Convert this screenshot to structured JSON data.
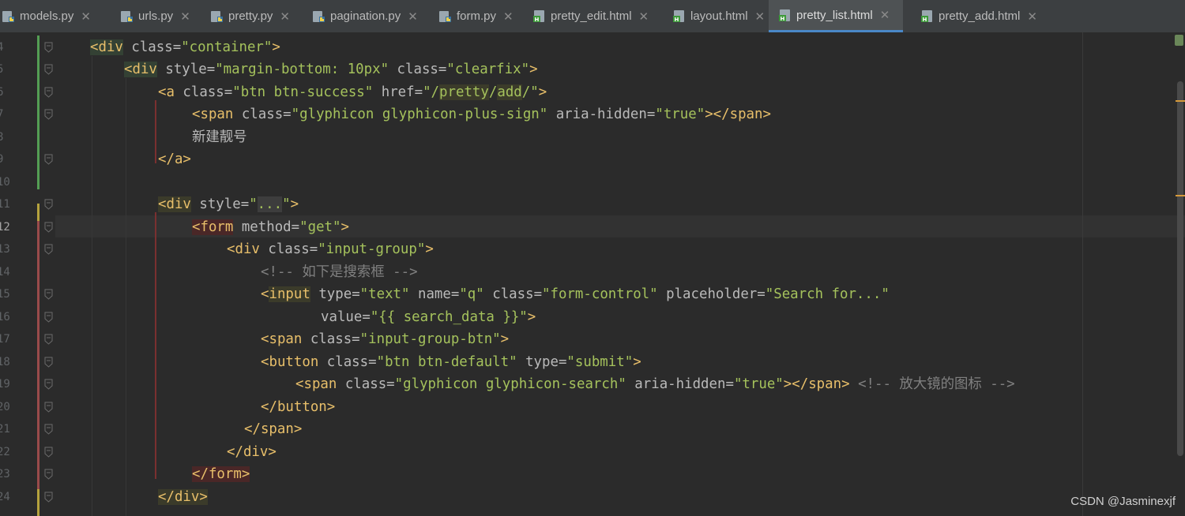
{
  "tabs": [
    {
      "label": "models.py",
      "kind": "python"
    },
    {
      "label": "urls.py",
      "kind": "python"
    },
    {
      "label": "pretty.py",
      "kind": "python"
    },
    {
      "label": "pagination.py",
      "kind": "python"
    },
    {
      "label": "form.py",
      "kind": "python"
    },
    {
      "label": "pretty_edit.html",
      "kind": "html"
    },
    {
      "label": "layout.html",
      "kind": "html"
    },
    {
      "label": "pretty_list.html",
      "kind": "html",
      "active": true
    },
    {
      "label": "pretty_add.html",
      "kind": "html"
    }
  ],
  "close_glyph": "✕",
  "line_numbers": [
    "4",
    "5",
    "6",
    "7",
    "8",
    "9",
    "10",
    "11",
    "12",
    "13",
    "14",
    "15",
    "16",
    "17",
    "18",
    "19",
    "20",
    "21",
    "22",
    "23",
    "24"
  ],
  "current_line": "12",
  "code_lines": [
    "<div class=\"container\">",
    "<div style=\"margin-bottom: 10px\" class=\"clearfix\">",
    "<a class=\"btn btn-success\" href=\"/pretty/add/\">",
    "<span class=\"glyphicon glyphicon-plus-sign\" aria-hidden=\"true\"></span>",
    "新建靓号",
    "</a>",
    "",
    "<div style=\"...\">",
    "<form method=\"get\">",
    "<div class=\"input-group\">",
    "<!-- 如下是搜索框 -->",
    "<input type=\"text\" name=\"q\" class=\"form-control\" placeholder=\"Search for...\"",
    "value=\"{{ search_data }}\">",
    "<span class=\"input-group-btn\">",
    "<button class=\"btn btn-default\" type=\"submit\">",
    "<span class=\"glyphicon glyphicon-search\" aria-hidden=\"true\"></span> <!-- 放大镜的图标 -->",
    "</button>",
    "</span>",
    "</div>",
    "</form>",
    "</div>"
  ],
  "colors": {
    "background": "#2b2b2b",
    "tag": "#e8bf6a",
    "string": "#a5c25c",
    "number": "#6897bb",
    "comment": "#808080",
    "active_tab_underline": "#4a88c7"
  },
  "watermark": "CSDN @Jasminexjf"
}
